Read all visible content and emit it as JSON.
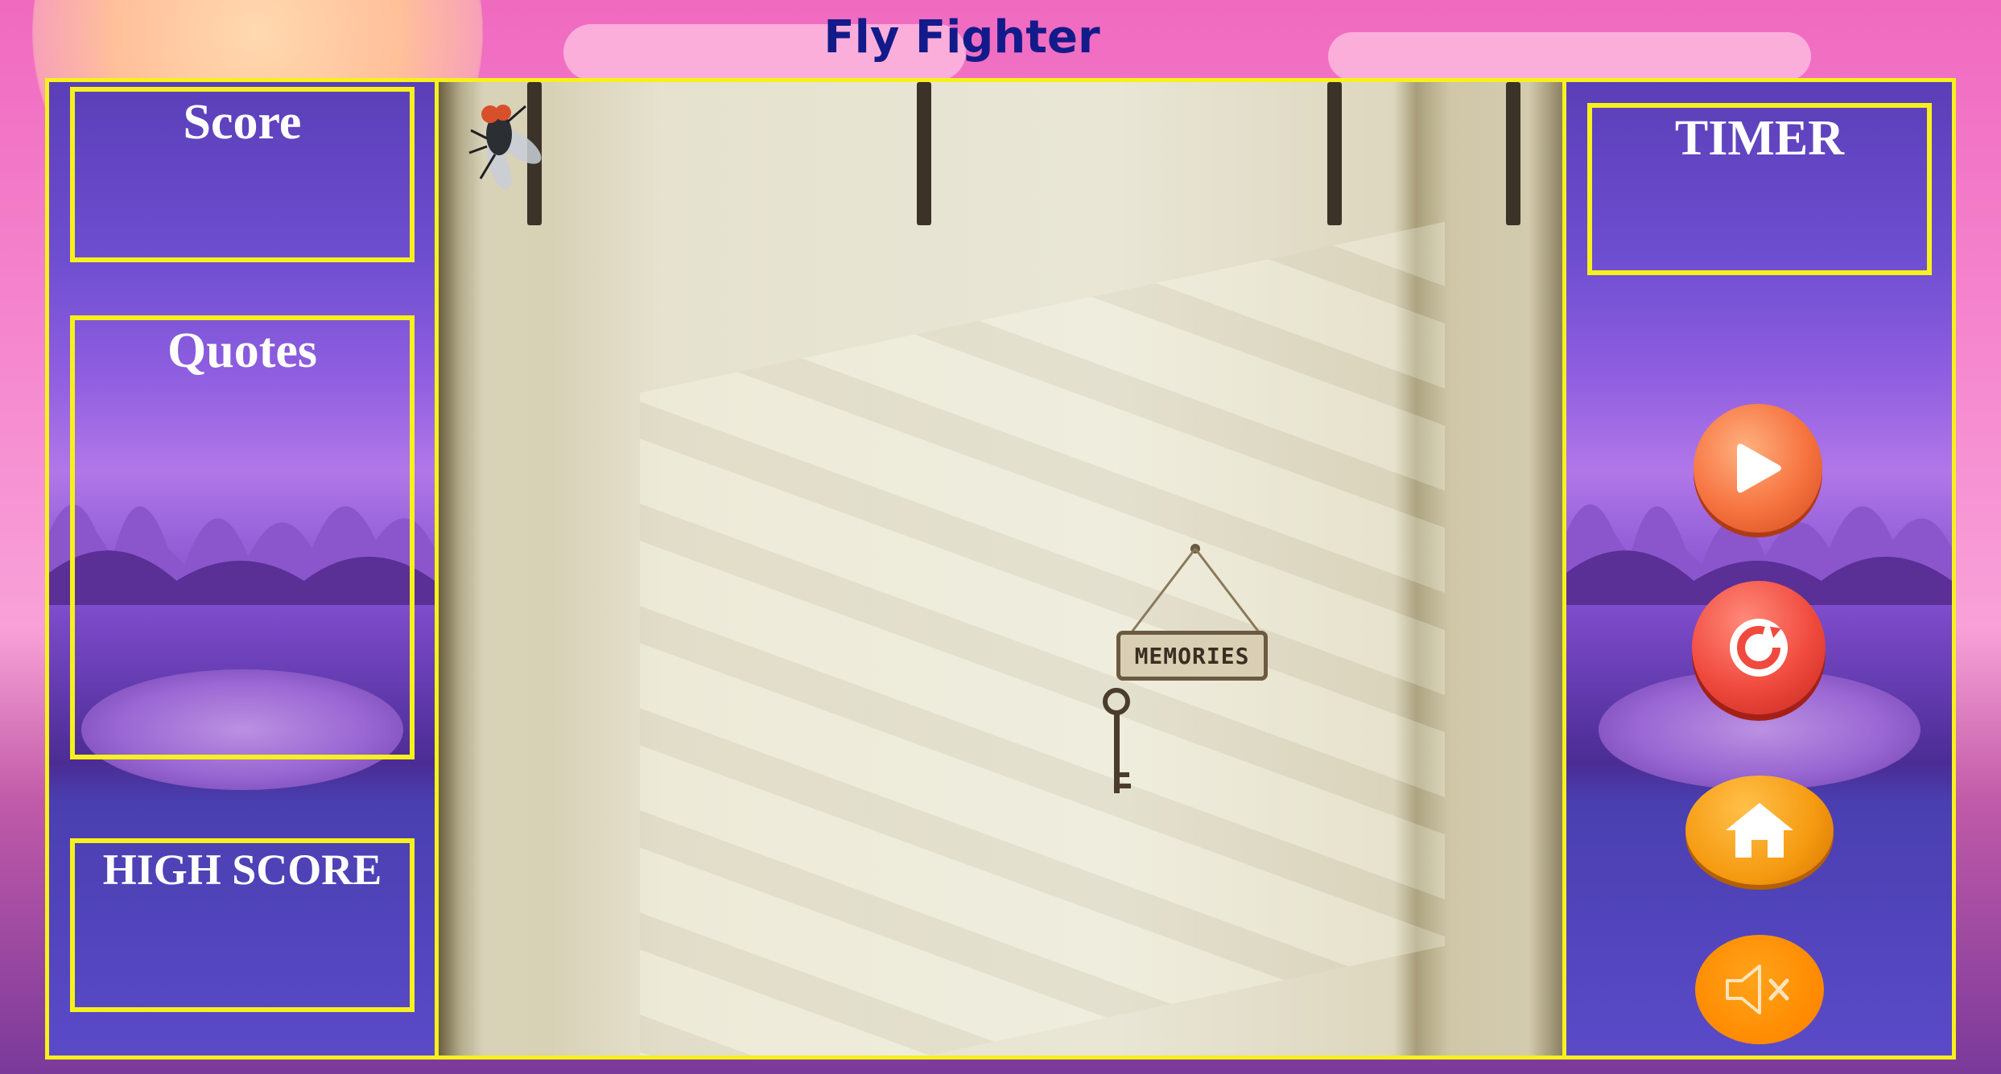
{
  "game": {
    "title": "Fly Fighter"
  },
  "left_panel": {
    "score_label": "Score",
    "score_value": "",
    "quotes_label": "Quotes",
    "quotes_value": "",
    "high_score_label": "HIGH SCORE",
    "high_score_value": ""
  },
  "right_panel": {
    "timer_label": "TIMER",
    "timer_value": "",
    "buttons": [
      {
        "icon": "play-icon"
      },
      {
        "icon": "restart-icon"
      },
      {
        "icon": "home-icon"
      },
      {
        "icon": "sound-muted-icon"
      }
    ]
  },
  "scene": {
    "sign_text": "MEMORIES",
    "fly_icon": "fly-icon",
    "key_icon": "key-icon"
  },
  "colors": {
    "border_yellow": "#f6f11c",
    "title_blue": "#131b8a",
    "button_orange": "#f6733f"
  }
}
